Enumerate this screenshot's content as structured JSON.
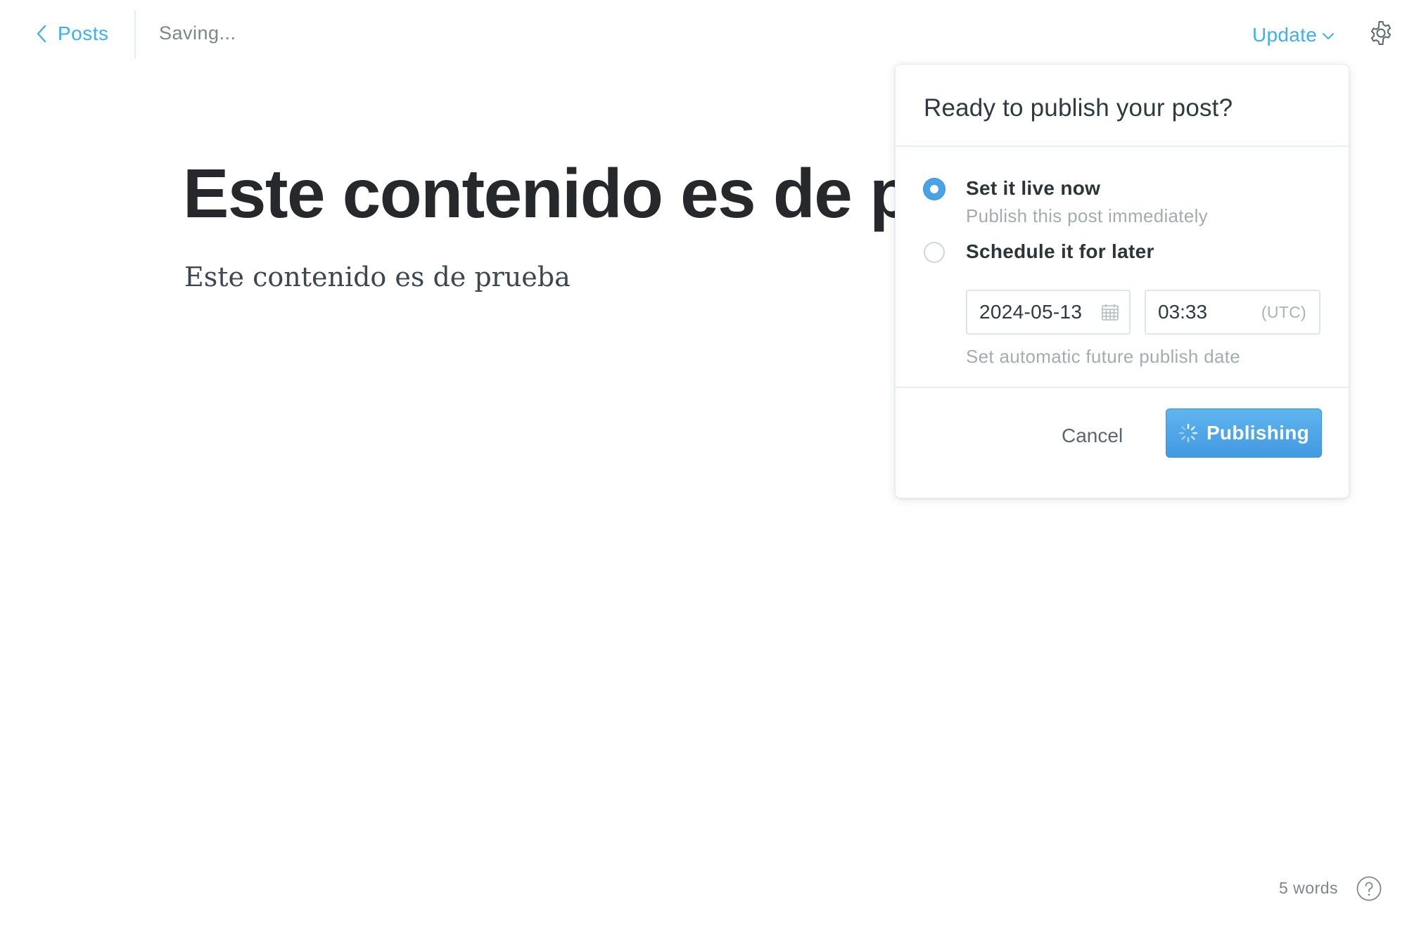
{
  "topbar": {
    "back_label": "Posts",
    "status": "Saving...",
    "update_label": "Update"
  },
  "editor": {
    "title": "Este contenido es de prueba",
    "body": "Este contenido es de prueba"
  },
  "publish_menu": {
    "heading": "Ready to publish your post?",
    "options": [
      {
        "title": "Set it live now",
        "description": "Publish this post immediately",
        "selected": true
      },
      {
        "title": "Schedule it for later",
        "selected": false
      }
    ],
    "schedule": {
      "date": "2024-05-13",
      "time": "03:33",
      "timezone": "(UTC)",
      "hint": "Set automatic future publish date"
    },
    "cancel_label": "Cancel",
    "publish_label": "Publishing"
  },
  "footer": {
    "word_count": "5 words"
  },
  "colors": {
    "accent": "#3eb0ef",
    "button_blue": "#4aa3e6",
    "text_dark": "#26282b",
    "muted": "#a3acb0"
  },
  "icons": {
    "back": "chevron-left-icon",
    "update_caret": "chevron-down-icon",
    "settings": "gear-icon",
    "calendar": "calendar-icon",
    "spinner": "spinner-icon",
    "help": "help-icon"
  }
}
